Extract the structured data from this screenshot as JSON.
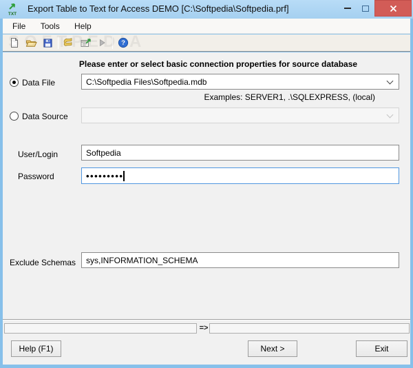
{
  "window": {
    "title": "Export Table to Text for Access DEMO [C:\\Softpedia\\Softpedia.prf]",
    "app_icon_text": "TXT"
  },
  "menu": {
    "items": [
      "File",
      "Tools",
      "Help"
    ]
  },
  "toolbar": {
    "watermark": "SOFTPEDIA",
    "help_glyph": "?",
    "icons": [
      "new-file-icon",
      "open-file-icon",
      "save-icon",
      "export-script-icon",
      "options-icon",
      "run-icon",
      "help-icon"
    ]
  },
  "form": {
    "header": "Please enter or select basic connection properties for source database",
    "data_file": {
      "label": "Data File",
      "value": "C:\\Softpedia Files\\Softpedia.mdb",
      "selected": true
    },
    "examples_hint": "Examples: SERVER1, .\\SQLEXPRESS, (local)",
    "data_source": {
      "label": "Data Source",
      "value": "",
      "selected": false
    },
    "user_login": {
      "label": "User/Login",
      "value": "Softpedia"
    },
    "password": {
      "label": "Password",
      "masked_value": "•••••••••"
    },
    "exclude_schemas": {
      "label": "Exclude Schemas",
      "value": "sys,INFORMATION_SCHEMA"
    },
    "status_arrow": "=>"
  },
  "buttons": {
    "help": "Help (F1)",
    "next": "Next >",
    "exit": "Exit"
  },
  "colors": {
    "titlebar": "#abd4f2",
    "window_border": "#87c0ea",
    "close_button": "#d25c57",
    "focus_border": "#4f96e0",
    "client_bg": "#f1f1f1"
  }
}
